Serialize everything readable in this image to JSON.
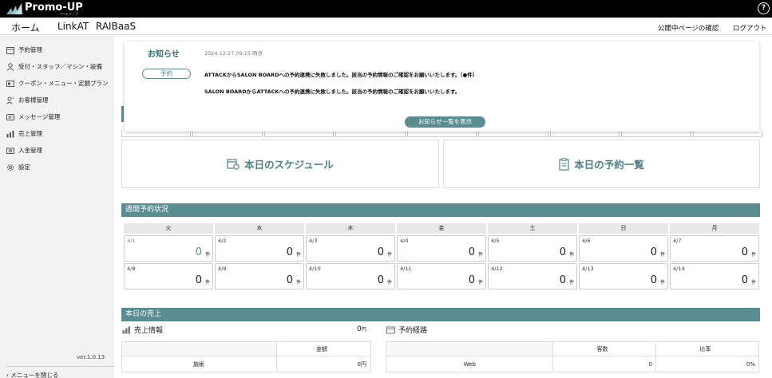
{
  "app": {
    "name": "Promo-UP",
    "subtitle": "プロモアップ"
  },
  "top_nav": {
    "tabs": [
      {
        "label": "ホーム",
        "active": true
      },
      {
        "label": "LinkAT",
        "active": false
      },
      {
        "label": "RAIBaaS",
        "active": false
      }
    ],
    "public_page_link": "公開中ページの確認",
    "logout": "ログアウト",
    "help": "?"
  },
  "sidebar": {
    "items": [
      {
        "label": "予約管理",
        "icon": "calendar-icon"
      },
      {
        "label": "受付・スタッフ／マシン・設備",
        "icon": "person-icon"
      },
      {
        "label": "クーポン・メニュー・定額プラン",
        "icon": "coupon-icon"
      },
      {
        "label": "お客様管理",
        "icon": "customer-icon"
      },
      {
        "label": "メッセージ管理",
        "icon": "message-icon"
      },
      {
        "label": "売上管理",
        "icon": "sales-icon"
      },
      {
        "label": "入金管理",
        "icon": "payment-icon"
      },
      {
        "label": "設定",
        "icon": "gear-icon"
      }
    ],
    "version": "ver.1.0.13",
    "close_menu": "メニューを閉じる"
  },
  "notice": {
    "title": "お知らせ",
    "date": "2024.12.27 09:15 時点",
    "badge": "予約",
    "lines": [
      "ATTACKからSALON BOARDへの予約連携に失敗しました。該当の予約情報のご確認をお願いいたします。（●件）",
      "SALON BOARDからATTACKへの予約連携に失敗しました。該当の予約情報のご確認をお願いいたします。"
    ],
    "list_button": "お知らせ一覧を表示"
  },
  "cards": {
    "schedule": "本日のスケジュール",
    "reservations": "本日の予約一覧"
  },
  "weekly": {
    "title": "週間予約状況",
    "days": [
      "火",
      "水",
      "木",
      "金",
      "土",
      "日",
      "月"
    ],
    "unit": "件",
    "rows": [
      [
        {
          "date": "4/1",
          "count": "0",
          "today": true
        },
        {
          "date": "4/2",
          "count": "0"
        },
        {
          "date": "4/3",
          "count": "0"
        },
        {
          "date": "4/4",
          "count": "0"
        },
        {
          "date": "4/5",
          "count": "0"
        },
        {
          "date": "4/6",
          "count": "0"
        },
        {
          "date": "4/7",
          "count": "0"
        }
      ],
      [
        {
          "date": "4/8",
          "count": "0"
        },
        {
          "date": "4/9",
          "count": "0"
        },
        {
          "date": "4/10",
          "count": "0"
        },
        {
          "date": "4/11",
          "count": "0"
        },
        {
          "date": "4/12",
          "count": "0"
        },
        {
          "date": "4/13",
          "count": "0"
        },
        {
          "date": "4/14",
          "count": "0"
        }
      ]
    ]
  },
  "sales": {
    "title": "本日の売上",
    "info_title": "売上情報",
    "info_amount": "0",
    "info_unit": "円",
    "info_table": {
      "header": "金額",
      "row_label": "施術",
      "row_value": "0円"
    },
    "route_title": "予約経路",
    "route_table": {
      "col1": "客数",
      "col2": "比率",
      "row_label": "Web",
      "row_count": "0",
      "row_ratio": "0%"
    }
  },
  "colors": {
    "accent": "#5a8d91",
    "topbar": "#000000"
  }
}
